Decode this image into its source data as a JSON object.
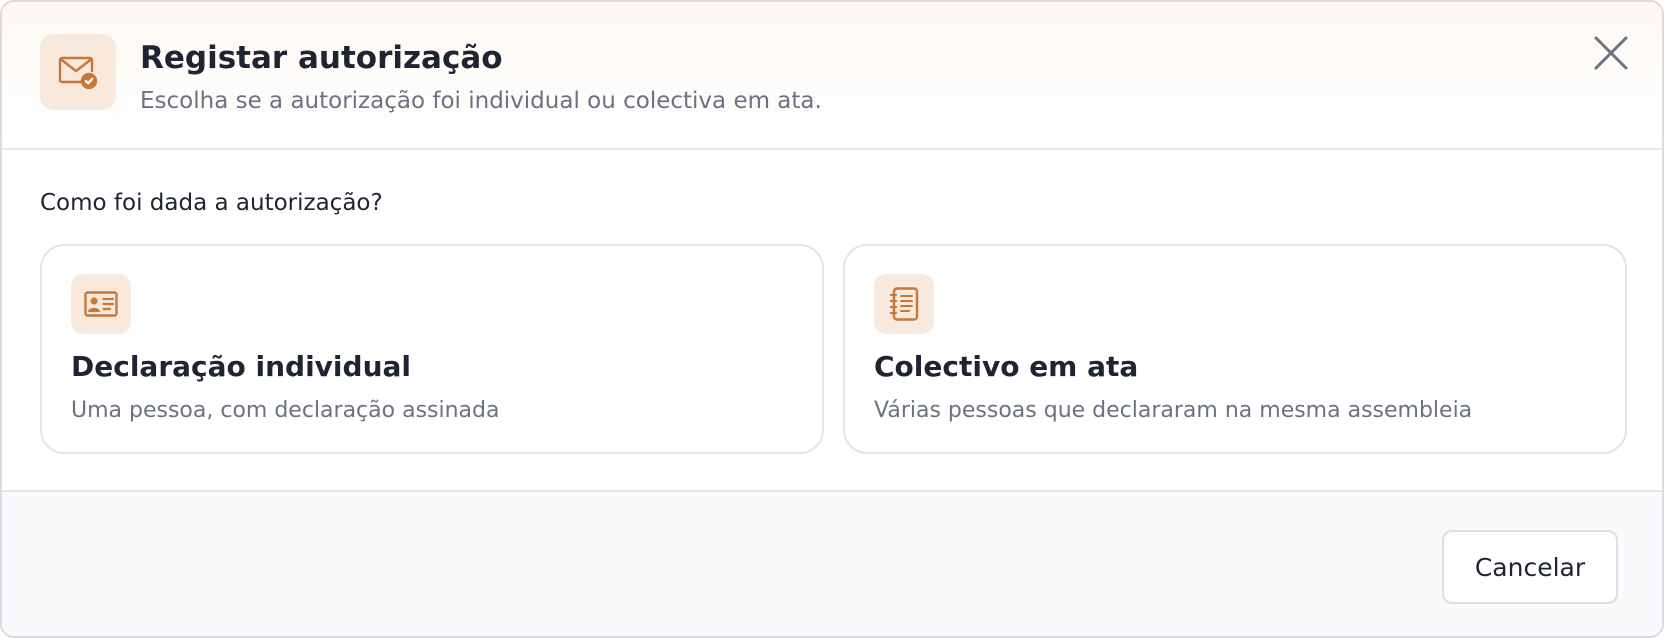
{
  "dialog": {
    "title": "Registar autorização",
    "subtitle": "Escolha se a autorização foi individual ou colectiva em ata.",
    "header_icon": "envelope-check-icon",
    "close_icon": "close-icon"
  },
  "question": "Como foi dada a autorização?",
  "options": [
    {
      "icon": "id-card-icon",
      "title": "Declaração individual",
      "description": "Uma pessoa, com declaração assinada"
    },
    {
      "icon": "notebook-list-icon",
      "title": "Colectivo em ata",
      "description": "Várias pessoas que declararam na mesma assembleia"
    }
  ],
  "footer": {
    "cancel_label": "Cancelar"
  },
  "colors": {
    "accent": "#c8773a",
    "icon_background": "#f8e9dc",
    "text_primary": "#1f2433",
    "text_secondary": "#6b7280",
    "footer_background": "#f9fafb"
  }
}
